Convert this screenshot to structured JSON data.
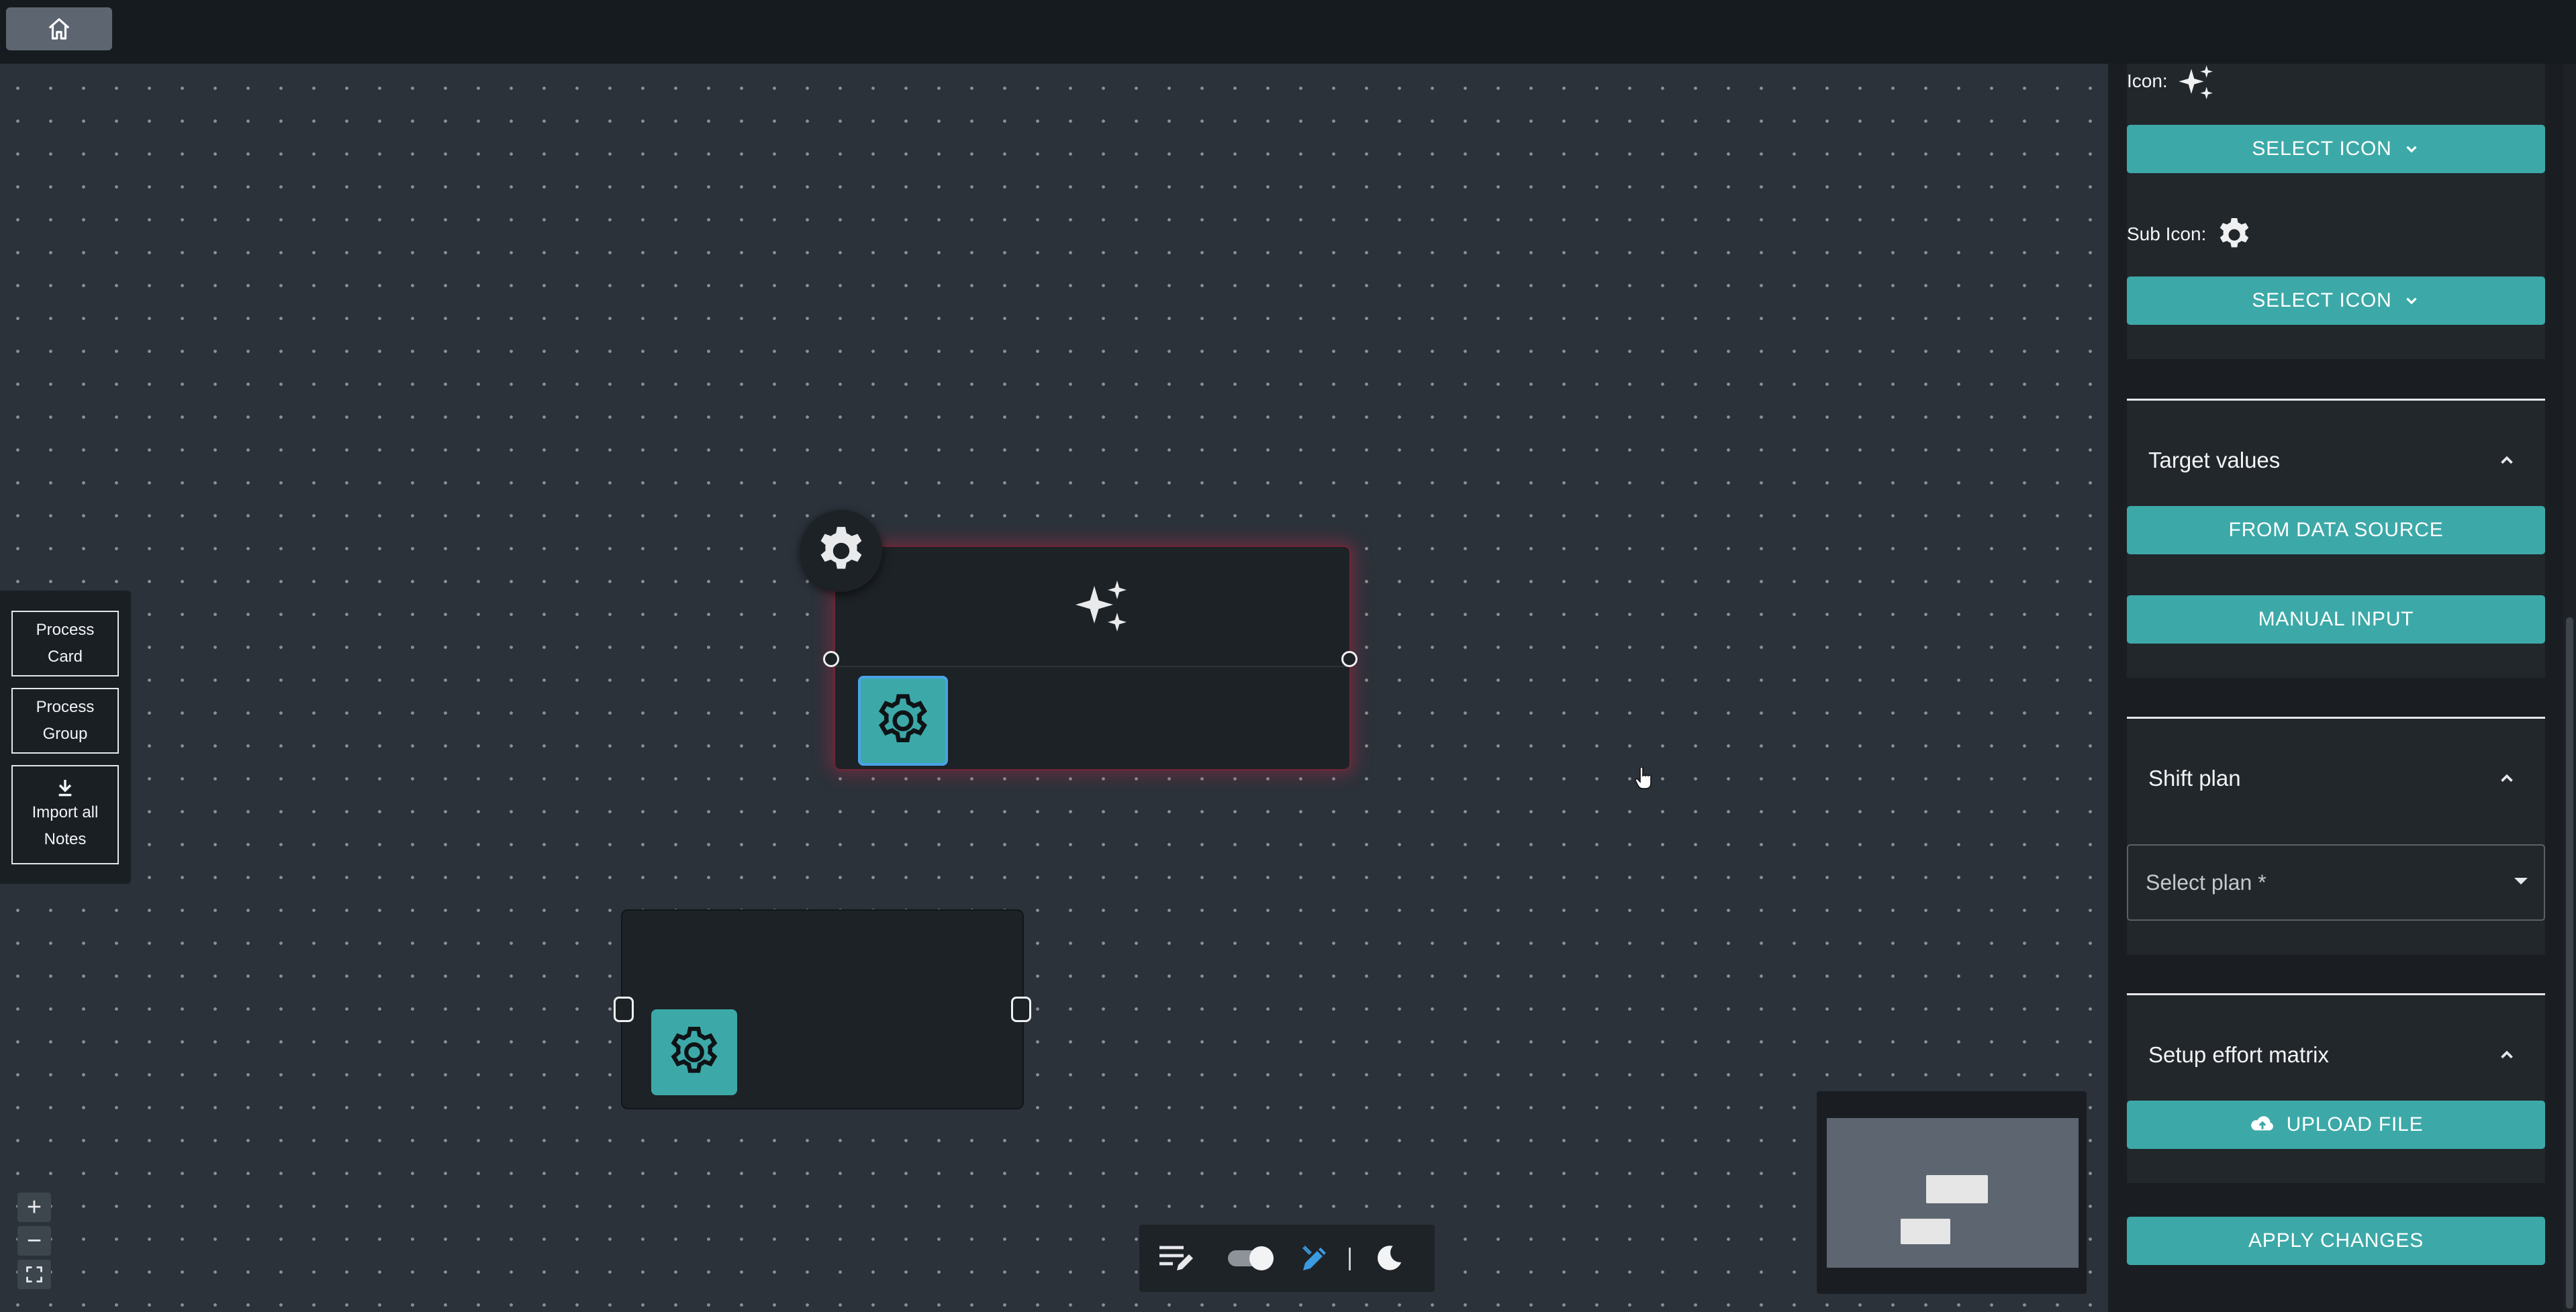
{
  "topbar": {
    "home_icon": "home-icon"
  },
  "left_panel": {
    "process_card": [
      "Process",
      "Card"
    ],
    "process_group": [
      "Process",
      "Group"
    ],
    "import_notes": [
      "Import all",
      "Notes"
    ]
  },
  "nodes": {
    "main": {
      "icon": "sparkles-icon",
      "sub_icon": "gear-icon",
      "selected": true
    },
    "second": {
      "sub_icon": "gear-icon"
    }
  },
  "zoom": {
    "in": "+",
    "out": "−",
    "fit": "fit-view-icon"
  },
  "toolbar": {
    "icons": [
      "notes-edit-icon",
      "toggle-icon",
      "pen-icon",
      "moon-icon"
    ]
  },
  "sidebar": {
    "icon_label": "Icon:",
    "select_icon_label": "SELECT ICON",
    "sub_icon_label": "Sub Icon:",
    "select_sub_icon_label": "SELECT ICON",
    "target_values": {
      "title": "Target values",
      "from_data_source": "FROM DATA SOURCE",
      "manual_input": "MANUAL INPUT"
    },
    "shift_plan": {
      "title": "Shift plan",
      "select_placeholder": "Select plan *"
    },
    "setup_effort": {
      "title": "Setup effort matrix",
      "upload_file": "UPLOAD FILE"
    },
    "apply_changes": "APPLY CHANGES"
  },
  "colors": {
    "accent": "#3ca9a8",
    "selection_glow": "#b42846",
    "canvas": "#2b323a",
    "panel": "#1a1e23"
  }
}
